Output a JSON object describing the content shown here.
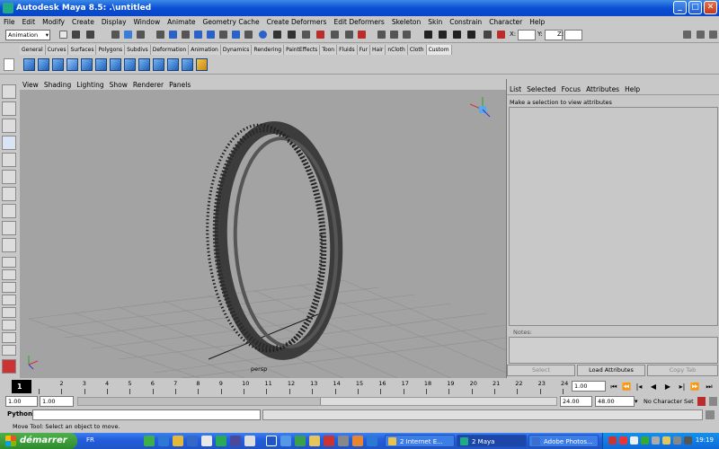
{
  "title": "Autodesk Maya 8.5: .\\untitled",
  "window_buttons": {
    "minimize": "_",
    "maximize": "□",
    "close": "✕"
  },
  "menus": [
    "File",
    "Edit",
    "Modify",
    "Create",
    "Display",
    "Window",
    "Animate",
    "Geometry Cache",
    "Create Deformers",
    "Edit Deformers",
    "Skeleton",
    "Skin",
    "Constrain",
    "Character",
    "Help"
  ],
  "status_line": {
    "mode": "Animation",
    "x_label": "X:",
    "y_label": "Y:",
    "z_label": "Z:",
    "x_value": "",
    "y_value": "",
    "z_value": ""
  },
  "shelf_tabs": [
    "General",
    "Curves",
    "Surfaces",
    "Polygons",
    "Subdivs",
    "Deformation",
    "Animation",
    "Dynamics",
    "Rendering",
    "PaintEffects",
    "Toon",
    "Fluids",
    "Fur",
    "Hair",
    "nCloth",
    "Cloth",
    "Custom"
  ],
  "active_shelf_tab": "Custom",
  "viewport": {
    "menus": [
      "View",
      "Shading",
      "Lighting",
      "Show",
      "Renderer",
      "Panels"
    ],
    "camera_label": "persp",
    "object": "tire"
  },
  "attribute_editor": {
    "menus": [
      "List",
      "Selected",
      "Focus",
      "Attributes",
      "Help"
    ],
    "message": "Make a selection to view attributes",
    "notes_label": "Notes:",
    "buttons": {
      "select": "Select",
      "load": "Load Attributes",
      "copy": "Copy Tab"
    }
  },
  "time_slider": {
    "current_frame": "1",
    "frames": [
      "1",
      "2",
      "3",
      "4",
      "5",
      "6",
      "7",
      "8",
      "9",
      "10",
      "11",
      "12",
      "13",
      "14",
      "15",
      "16",
      "17",
      "18",
      "19",
      "20",
      "21",
      "22",
      "23",
      "24"
    ],
    "current_time_field": "1.00"
  },
  "range_slider": {
    "start_time": "1.00",
    "playback_start": "1.00",
    "playback_end": "24.00",
    "end_time": "48.00",
    "character_set": "No Character Set"
  },
  "command_line": {
    "label": "Python",
    "input": ""
  },
  "help_line": "Move Tool: Select an object to move.",
  "taskbar": {
    "start": "démarrer",
    "language": "FR",
    "tasks": [
      {
        "label": "2 Internet E...",
        "active": false
      },
      {
        "label": "2 Maya",
        "active": true
      },
      {
        "label": "Adobe Photos...",
        "active": false
      }
    ],
    "clock": "19:19"
  },
  "colors": {
    "titlebar": "#0a4fd6",
    "ui_gray": "#c8c8c8",
    "viewport_bg": "#a3a3a3",
    "taskbar": "#245edc",
    "start_button": "#2d8b2c"
  }
}
